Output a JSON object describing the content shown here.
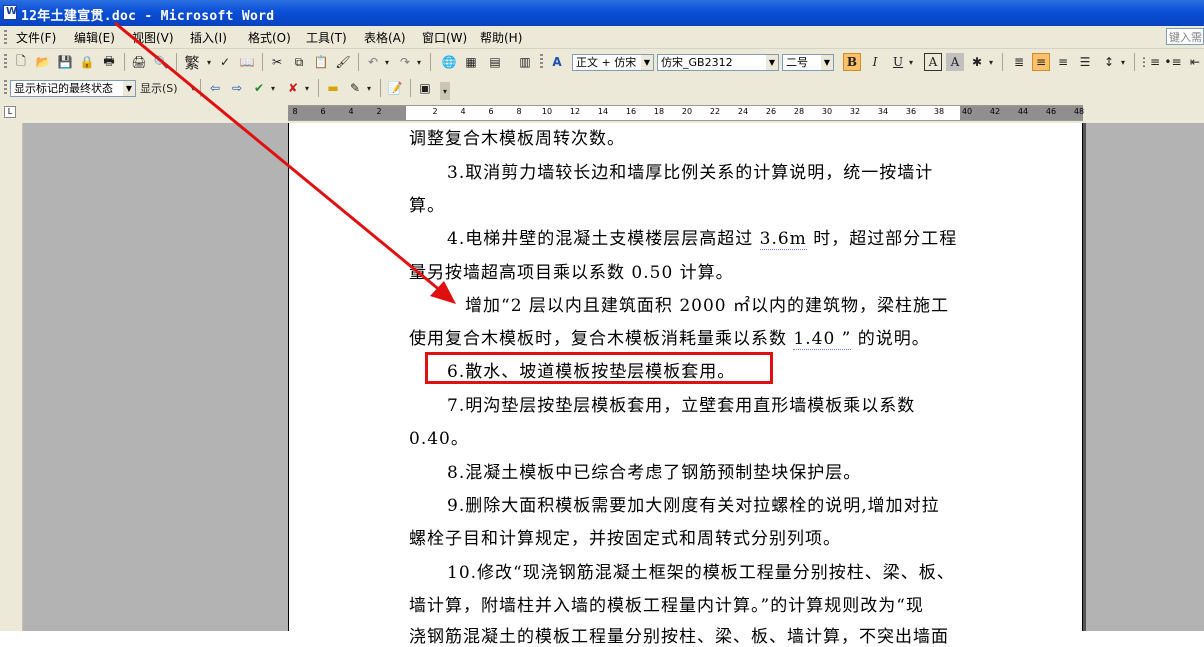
{
  "window": {
    "title": "12年土建宣贯.doc - Microsoft Word"
  },
  "menu": {
    "items": [
      "文件(F)",
      "编辑(E)",
      "视图(V)",
      "插入(I)",
      "格式(O)",
      "工具(T)",
      "表格(A)",
      "窗口(W)",
      "帮助(H)"
    ],
    "ask_placeholder": "键入需"
  },
  "format_toolbar": {
    "traditional_label": "繁",
    "style": "正文 + 仿宋",
    "font": "仿宋_GB2312",
    "size": "二号",
    "bold": "B",
    "italic": "I",
    "underline": "U",
    "char_border": "A",
    "char_shading": "A"
  },
  "review_toolbar": {
    "markup_view": "显示标记的最终状态",
    "show_label": "显示(S)"
  },
  "ruler": {
    "ticks": [
      "8",
      "6",
      "4",
      "2",
      "2",
      "4",
      "6",
      "8",
      "10",
      "12",
      "14",
      "16",
      "18",
      "20",
      "22",
      "24",
      "26",
      "28",
      "30",
      "32",
      "34",
      "36",
      "38",
      "40",
      "42",
      "44",
      "46",
      "48"
    ]
  },
  "document": {
    "lines": [
      "调整复合木模板周转次数。",
      "3.取消剪力墙较长边和墙厚比例关系的计算说明，统一按墙计",
      "算。",
      "4.电梯井壁的混凝土支模楼层层高超过",
      "3.6m",
      "时，超过部分工程",
      "量另按墙超高项目乘以系数 0.50 计算。",
      "增加“2 层以内且建筑面积 2000 ㎡以内的建筑物，梁柱施工",
      "使用复合木模板时，复合木模板消耗量乘以系数",
      "1.40 ”",
      "的说明。",
      "6.散水、坡道模板按垫层模板套用。",
      "7.明沟垫层按垫层模板套用，立壁套用直形墙模板乘以系数",
      "0.40。",
      "8.混凝土模板中已综合考虑了钢筋预制垫块保护层。",
      "9.删除大面积模板需要加大刚度有关对拉螺栓的说明,增加对拉",
      "螺栓子目和计算规定，并按固定式和周转式分别列项。",
      "10.修改“现浇钢筋混凝土框架的模板工程量分别按柱、梁、板、",
      "墙计算，附墙柱并入墙的模板工程量内计算。”的计算规则改为“现",
      "浇钢筋混凝土的模板工程量分别按柱、梁、板、墙计算，不突出墙面"
    ]
  },
  "annotation": {
    "arrow_color": "#e01010",
    "box_color": "#e01010"
  }
}
